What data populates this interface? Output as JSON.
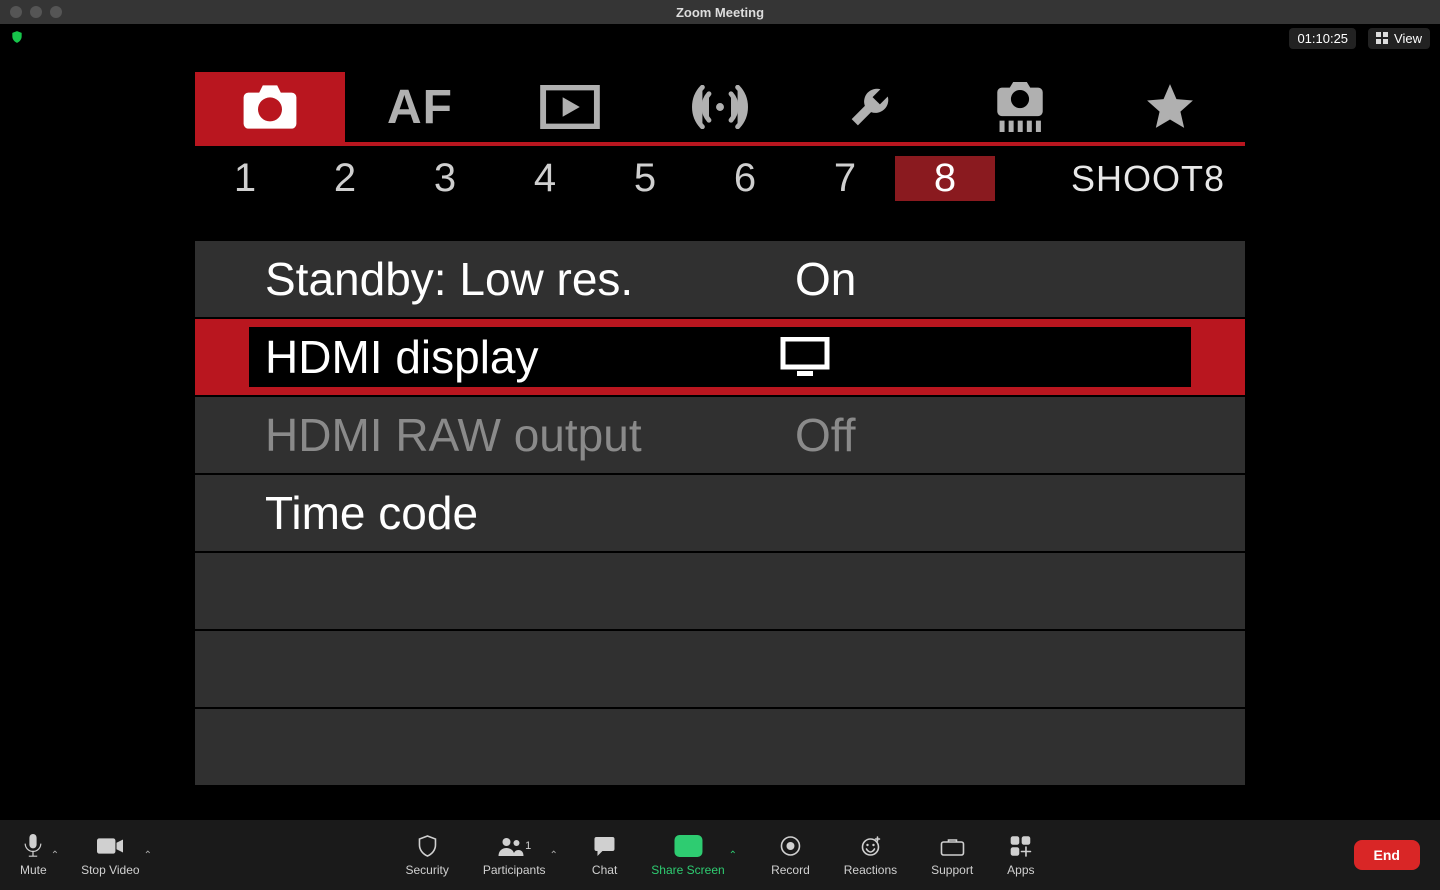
{
  "window": {
    "title": "Zoom Meeting"
  },
  "info_strip": {
    "timer": "01:10:25",
    "view_label": "View"
  },
  "camera": {
    "category_tabs": [
      {
        "name": "camera-icon"
      },
      {
        "name": "af-label",
        "label": "AF"
      },
      {
        "name": "playback-icon"
      },
      {
        "name": "wireless-icon"
      },
      {
        "name": "wrench-icon"
      },
      {
        "name": "custom-fn-icon"
      },
      {
        "name": "star-icon"
      }
    ],
    "pages": {
      "numbers": [
        "1",
        "2",
        "3",
        "4",
        "5",
        "6",
        "7",
        "8"
      ],
      "selected_index": 7,
      "page_label": "SHOOT8"
    },
    "settings": [
      {
        "label": "Standby: Low res.",
        "value": "On",
        "state": "normal"
      },
      {
        "label": "HDMI display",
        "value_icon": "monitor-icon",
        "state": "selected"
      },
      {
        "label": "HDMI RAW output",
        "value": "Off",
        "state": "dim"
      },
      {
        "label": "Time code",
        "value": "",
        "state": "normal"
      },
      {
        "label": "",
        "value": "",
        "state": "empty"
      },
      {
        "label": "",
        "value": "",
        "state": "empty"
      },
      {
        "label": "",
        "value": "",
        "state": "empty"
      }
    ]
  },
  "toolbar": {
    "mute": "Mute",
    "stop_video": "Stop Video",
    "security": "Security",
    "participants": "Participants",
    "participants_count": "1",
    "chat": "Chat",
    "share_screen": "Share Screen",
    "record": "Record",
    "reactions": "Reactions",
    "support": "Support",
    "apps": "Apps",
    "end": "End"
  }
}
